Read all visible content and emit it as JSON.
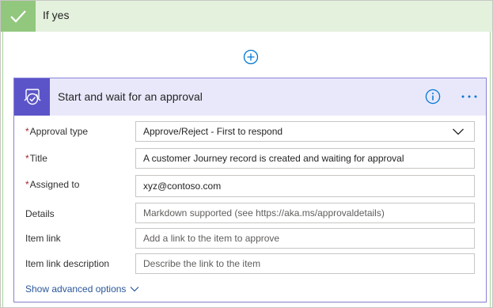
{
  "condition": {
    "branch_label": "If yes",
    "icons": {
      "check": "checkmark-icon",
      "add": "plus-circle-icon"
    },
    "colors": {
      "branch_bg": "#e3f1dd",
      "branch_accent": "#92c77e"
    }
  },
  "action_card": {
    "title": "Start and wait for an approval",
    "icons": {
      "action": "approval-icon",
      "info": "info-icon",
      "more": "more-dots-icon"
    },
    "colors": {
      "header_bg": "#e9e8fb",
      "icon_bg": "#5b54c9",
      "border": "#8a84d8"
    },
    "fields": {
      "approval_type": {
        "label": "Approval type",
        "required": "*",
        "value": "Approve/Reject - First to respond"
      },
      "title": {
        "label": "Title",
        "required": "*",
        "value": "A customer Journey record is created and waiting for approval"
      },
      "assigned_to": {
        "label": "Assigned to",
        "required": "*",
        "value": "xyz@contoso.com"
      },
      "details": {
        "label": "Details",
        "placeholder": "Markdown supported (see https://aka.ms/approvaldetails)"
      },
      "item_link": {
        "label": "Item link",
        "placeholder": "Add a link to the item to approve"
      },
      "item_link_description": {
        "label": "Item link description",
        "placeholder": "Describe the link to the item"
      }
    },
    "show_advanced": "Show advanced options"
  }
}
